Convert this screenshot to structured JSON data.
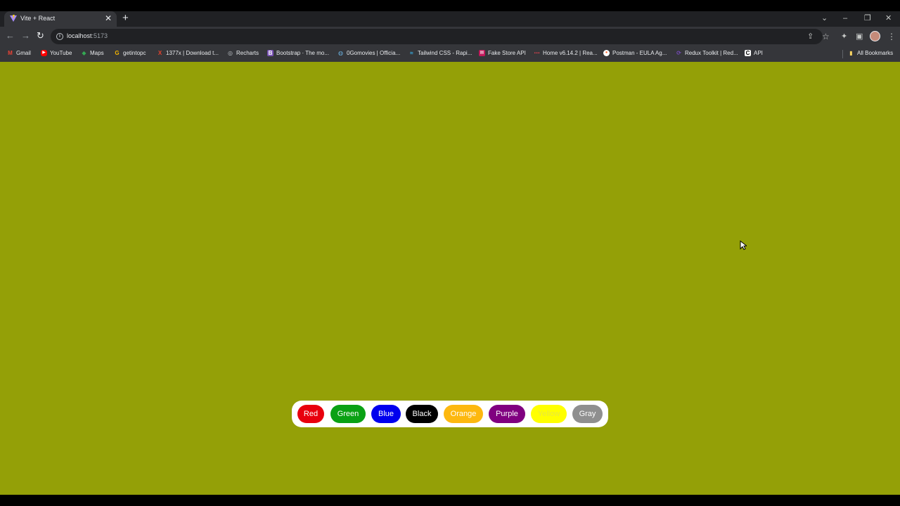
{
  "browser": {
    "tab_title": "Vite + React",
    "tab_close": "✕",
    "new_tab": "+",
    "window_controls": {
      "dropdown": "⌄",
      "minimize": "–",
      "restore": "❐",
      "close": "✕"
    },
    "url_host": "localhost",
    "url_port": ":5173",
    "nav": {
      "back": "←",
      "forward": "→",
      "reload": "↻"
    },
    "toolbar_icons": {
      "share": "⇪",
      "star": "☆",
      "extensions": "✦",
      "sidepanel": "▣",
      "menu": "⋮"
    },
    "info_glyph": "i"
  },
  "bookmarks": [
    {
      "label": "Gmail",
      "icon": "gmail-icon",
      "glyph": "M",
      "color": "#ea4335"
    },
    {
      "label": "YouTube",
      "icon": "youtube-icon",
      "glyph": "▶",
      "color": "#ff0000"
    },
    {
      "label": "Maps",
      "icon": "maps-icon",
      "glyph": "◆",
      "color": "#34a853"
    },
    {
      "label": "getintopc",
      "icon": "getintopc-icon",
      "glyph": "G",
      "color": "#f4b400"
    },
    {
      "label": "1377x | Download t...",
      "icon": "1377x-icon",
      "glyph": "X",
      "color": "#e8412c"
    },
    {
      "label": "Recharts",
      "icon": "recharts-icon",
      "glyph": "◎",
      "color": "#bdc1c6"
    },
    {
      "label": "Bootstrap · The mo...",
      "icon": "bootstrap-icon",
      "glyph": "B",
      "color": "#7952b3"
    },
    {
      "label": "0Gomovies | Officia...",
      "icon": "gomovies-icon",
      "glyph": "◍",
      "color": "#6ab0de"
    },
    {
      "label": "Tailwind CSS - Rapi...",
      "icon": "tailwind-icon",
      "glyph": "≈",
      "color": "#38bdf8"
    },
    {
      "label": "Fake Store API",
      "icon": "fakestore-icon",
      "glyph": "▤",
      "color": "#c2185b"
    },
    {
      "label": "Home v6.14.2 | Rea...",
      "icon": "reactrouter-icon",
      "glyph": "⋯",
      "color": "#f44250"
    },
    {
      "label": "Postman - EULA Ag...",
      "icon": "postman-icon",
      "glyph": "●",
      "color": "#ff6c37"
    },
    {
      "label": "Redux Toolkit | Red...",
      "icon": "redux-icon",
      "glyph": "⟳",
      "color": "#764abc"
    },
    {
      "label": "API",
      "icon": "api-icon",
      "glyph": "C",
      "color": "#ffffff"
    }
  ],
  "all_bookmarks": {
    "label": "All Bookmarks",
    "icon": "folder-icon",
    "glyph": "▮",
    "color": "#fdd663"
  },
  "page": {
    "background": "#94a007"
  },
  "buttons": [
    {
      "label": "Red",
      "bg": "#e8000d",
      "fg": "#ffffff"
    },
    {
      "label": "Green",
      "bg": "#0aa114",
      "fg": "#ffffff"
    },
    {
      "label": "Blue",
      "bg": "#0000ee",
      "fg": "#ffffff"
    },
    {
      "label": "Black",
      "bg": "#000000",
      "fg": "#ffffff"
    },
    {
      "label": "Orange",
      "bg": "#fdb80f",
      "fg": "#ffffff"
    },
    {
      "label": "Purple",
      "bg": "#800080",
      "fg": "#ffffff"
    },
    {
      "label": "Yellow",
      "bg": "#ffff00",
      "fg": "#e8e840"
    },
    {
      "label": "Gray",
      "bg": "#8f8f8f",
      "fg": "#ffffff"
    }
  ]
}
